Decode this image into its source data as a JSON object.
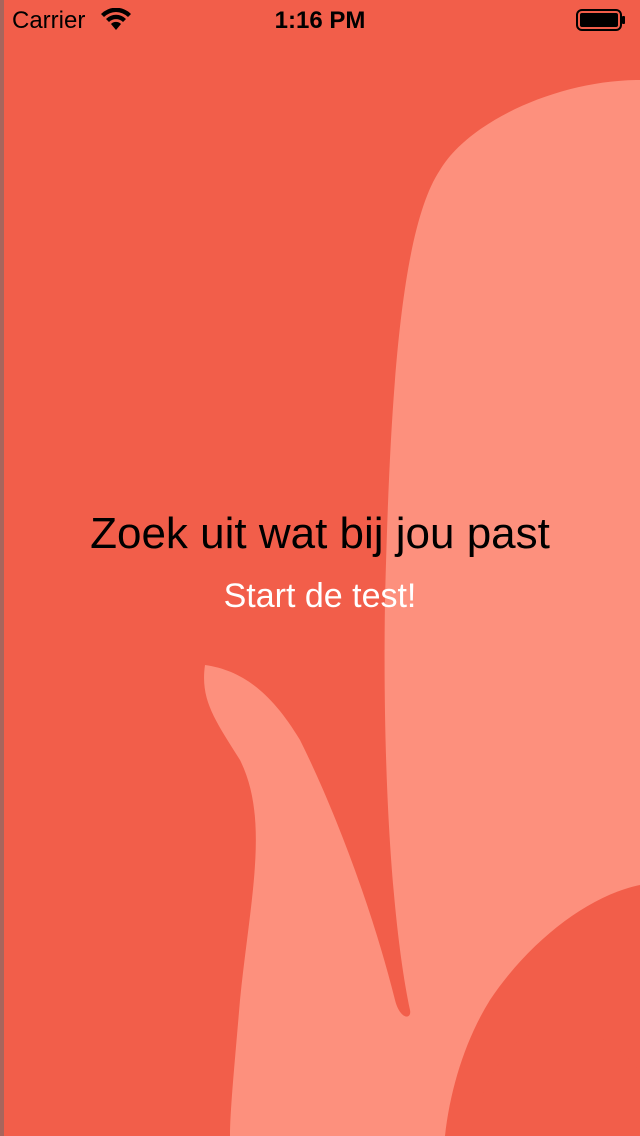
{
  "status_bar": {
    "carrier": "Carrier",
    "time": "1:16 PM",
    "wifi_icon": "wifi-icon",
    "battery_icon": "battery-icon"
  },
  "hero": {
    "title": "Zoek uit wat bij jou past",
    "cta_label": "Start de test!"
  },
  "colors": {
    "background": "#f25e4a",
    "shape": "#fd907d",
    "cta_text": "#ffffff",
    "title_text": "#000000"
  }
}
